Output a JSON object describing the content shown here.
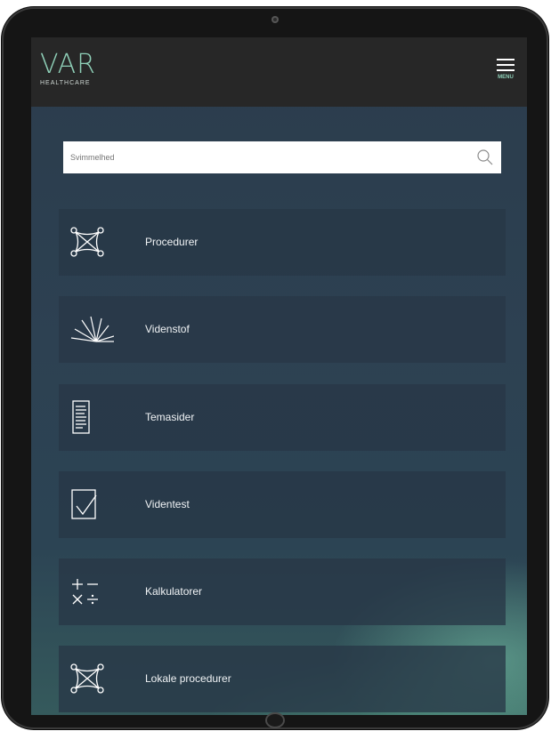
{
  "header": {
    "logo_mark": "VAR",
    "logo_sub": "HEALTHCARE",
    "menu_label": "MENU"
  },
  "search": {
    "placeholder": "Svimmelhed",
    "icon": "search-icon"
  },
  "menu": {
    "items": [
      {
        "label": "Procedurer",
        "icon": "procedure-network-icon"
      },
      {
        "label": "Videnstof",
        "icon": "fan-rays-icon"
      },
      {
        "label": "Temasider",
        "icon": "document-icon"
      },
      {
        "label": "Videntest",
        "icon": "checkbox-icon"
      },
      {
        "label": "Kalkulatorer",
        "icon": "calculator-symbols-icon"
      },
      {
        "label": "Lokale procedurer",
        "icon": "procedure-network-icon"
      }
    ]
  },
  "colors": {
    "header_bg": "#272727",
    "accent": "#8fd0b8",
    "tile_bg": "#283746"
  }
}
